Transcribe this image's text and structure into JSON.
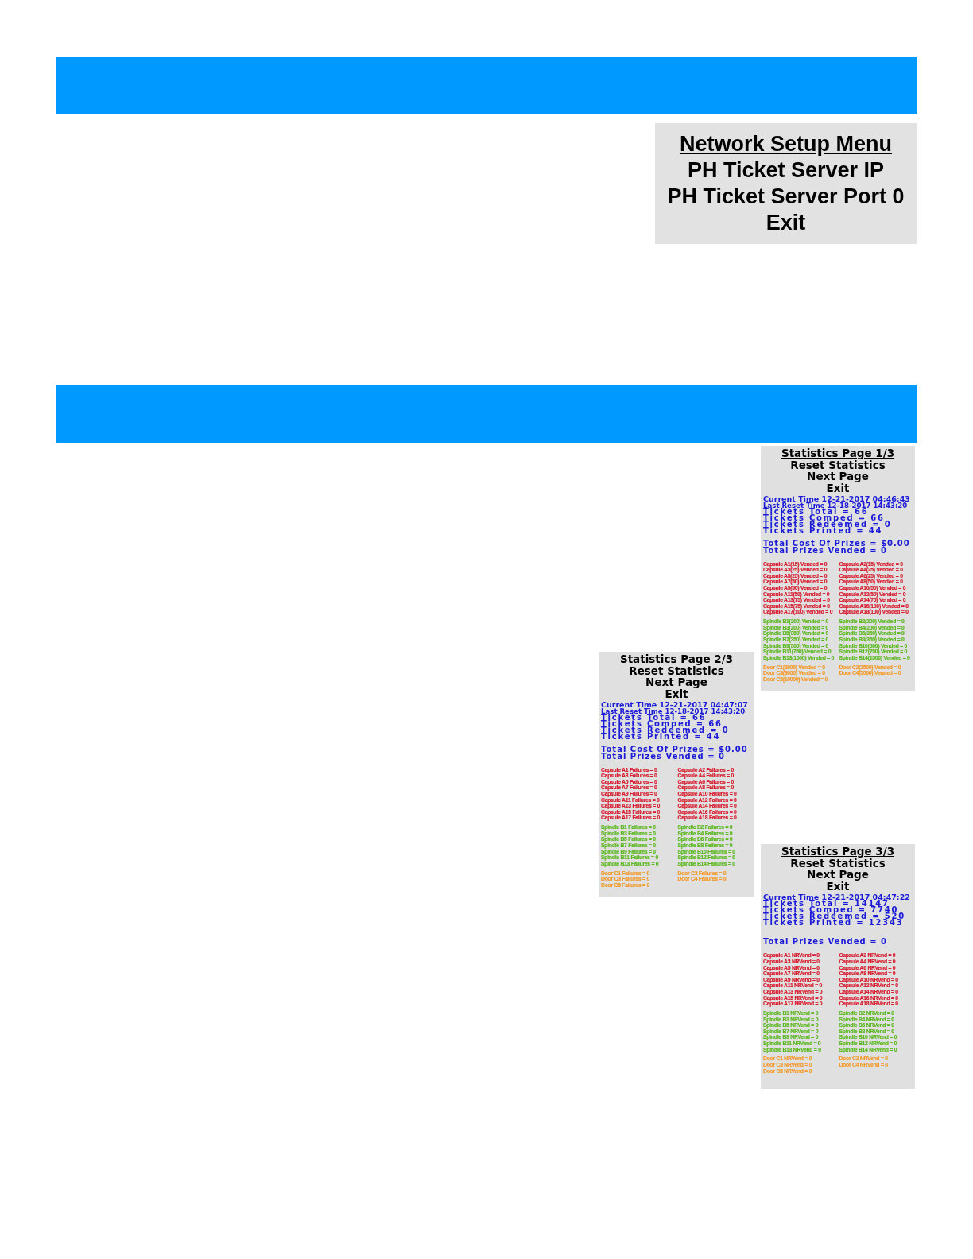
{
  "network_menu": {
    "title": "Network Setup Menu",
    "items": [
      "PH Ticket Server IP",
      "PH Ticket Server Port 0",
      "Exit"
    ]
  },
  "statistics_pages": [
    {
      "title": "Statistics Page 1/3",
      "menu": [
        "Reset Statistics",
        "Next Page",
        "Exit"
      ],
      "time_lines": [
        "Current Time 12-21-2017 04:46:43",
        "Last Reset Time 12-18-2017 14:43:20"
      ],
      "ticket_lines": [
        "Tickets Total = 66",
        "Tickets Comped = 66",
        "Tickets Redeemed = 0",
        "Tickets Printed = 44"
      ],
      "prize_lines": [
        "Total Cost Of Prizes = $0.00",
        "Total Prizes Vended = 0"
      ],
      "groups": [
        {
          "color": "#d81a2c",
          "entries": [
            "Capsule A1(15) Vended = 0",
            "Capsule A2(15) Vended = 0",
            "Capsule A3(25) Vended = 0",
            "Capsule A4(25) Vended = 0",
            "Capsule A5(25) Vended = 0",
            "Capsule A6(25) Vended = 0",
            "Capsule A7(50) Vended = 0",
            "Capsule A8(50) Vended = 0",
            "Capsule A9(50) Vended = 0",
            "Capsule A10(50) Vended = 0",
            "Capsule A11(50) Vended = 0",
            "Capsule A12(50) Vended = 0",
            "Capsule A13(75) Vended = 0",
            "Capsule A14(75) Vended = 0",
            "Capsule A15(75) Vended = 0",
            "Capsule A16(100) Vended = 0",
            "Capsule A17(100) Vended = 0",
            "Capsule A18(100) Vended = 0"
          ]
        },
        {
          "color": "#5ab81e",
          "entries": [
            "Spindle B1(200) Vended = 0",
            "Spindle B2(200) Vended = 0",
            "Spindle B3(200) Vended = 0",
            "Spindle B4(200) Vended = 0",
            "Spindle B5(350) Vended = 0",
            "Spindle B6(350) Vended = 0",
            "Spindle B7(350) Vended = 0",
            "Spindle B8(350) Vended = 0",
            "Spindle B9(500) Vended = 0",
            "Spindle B10(500) Vended = 0",
            "Spindle B11(750) Vended = 0",
            "Spindle B12(750) Vended = 0",
            "Spindle B13(1000) Vended = 0",
            "Spindle B14(1500) Vended = 0"
          ]
        },
        {
          "color": "#f39a2a",
          "entries": [
            "Door C1(2000) Vended = 0",
            "Door C2(2500) Vended = 0",
            "Door C3(3000) Vended = 0",
            "Door C4(5000) Vended = 0",
            "Door C5(10000) Vended = 0"
          ]
        }
      ]
    },
    {
      "title": "Statistics Page 2/3",
      "menu": [
        "Reset Statistics",
        "Next Page",
        "Exit"
      ],
      "time_lines": [
        "Current Time 12-21-2017 04:47:07",
        "Last Reset Time 12-18-2017 14:43:20"
      ],
      "ticket_lines": [
        "Tickets Total = 66",
        "Tickets Comped = 66",
        "Tickets Redeemed = 0",
        "Tickets Printed = 44"
      ],
      "prize_lines": [
        "Total Cost Of Prizes = $0.00",
        "Total Prizes Vended = 0"
      ],
      "groups": [
        {
          "color": "#d81a2c",
          "entries": [
            "Capsule A1 Failures = 0",
            "Capsule A2 Failures = 0",
            "Capsule A3 Failures = 0",
            "Capsule A4 Failures = 0",
            "Capsule A5 Failures = 0",
            "Capsule A6 Failures = 0",
            "Capsule A7 Failures = 0",
            "Capsule A8 Failures = 0",
            "Capsule A9 Failures = 0",
            "Capsule A10 Failures = 0",
            "Capsule A11 Failures = 0",
            "Capsule A12 Failures = 0",
            "Capsule A13 Failures = 0",
            "Capsule A14 Failures = 0",
            "Capsule A15 Failures = 0",
            "Capsule A16 Failures = 0",
            "Capsule A17 Failures = 0",
            "Capsule A18 Failures = 0"
          ]
        },
        {
          "color": "#5ab81e",
          "entries": [
            "Spindle B1 Failures = 0",
            "Spindle B2 Failures = 0",
            "Spindle B3 Failures = 0",
            "Spindle B4 Failures = 0",
            "Spindle B5 Failures = 0",
            "Spindle B6 Failures = 0",
            "Spindle B7 Failures = 0",
            "Spindle B8 Failures = 0",
            "Spindle B9 Failures = 0",
            "Spindle B10 Failures = 0",
            "Spindle B11 Failures = 0",
            "Spindle B12 Failures = 0",
            "Spindle B13 Failures = 0",
            "Spindle B14 Failures = 0"
          ]
        },
        {
          "color": "#f39a2a",
          "entries": [
            "Door C1 Failures = 0",
            "Door C2 Failures = 0",
            "Door C3 Failures = 0",
            "Door C4 Failures = 0",
            "Door C5 Failures = 0"
          ]
        }
      ]
    },
    {
      "title": "Statistics Page 3/3",
      "menu": [
        "Reset Statistics",
        "Next Page",
        "Exit"
      ],
      "time_lines": [
        "Current Time 12-21-2017 04:47:22"
      ],
      "ticket_lines": [
        "Tickets Total = 14147",
        "Tickets Comped = 7740",
        "Tickets Redeemed = 520",
        "Tickets Printed = 12343"
      ],
      "prize_lines": [
        "Total Prizes Vended = 0"
      ],
      "groups": [
        {
          "color": "#d81a2c",
          "entries": [
            "Capsule A1 NRVend = 0",
            "Capsule A2 NRVend = 0",
            "Capsule A3 NRVend = 0",
            "Capsule A4 NRVend = 0",
            "Capsule A5 NRVend = 0",
            "Capsule A6 NRVend = 0",
            "Capsule A7 NRVend = 0",
            "Capsule A8 NRVend = 0",
            "Capsule A9 NRVend = 0",
            "Capsule A10 NRVend = 0",
            "Capsule A11 NRVend = 0",
            "Capsule A12 NRVend = 0",
            "Capsule A13 NRVend = 0",
            "Capsule A14 NRVend = 0",
            "Capsule A15 NRVend = 0",
            "Capsule A16 NRVend = 0",
            "Capsule A17 NRVend = 0",
            "Capsule A18 NRVend = 0"
          ]
        },
        {
          "color": "#5ab81e",
          "entries": [
            "Spindle B1 NRVend = 0",
            "Spindle B2 NRVend = 0",
            "Spindle B3 NRVend = 0",
            "Spindle B4 NRVend = 0",
            "Spindle B5 NRVend = 0",
            "Spindle B6 NRVend = 0",
            "Spindle B7 NRVend = 0",
            "Spindle B8 NRVend = 0",
            "Spindle B9 NRVend = 0",
            "Spindle B10 NRVend = 0",
            "Spindle B11 NRVend = 0",
            "Spindle B12 NRVend = 0",
            "Spindle B13 NRVend = 0",
            "Spindle B14 NRVend = 0"
          ]
        },
        {
          "color": "#f39a2a",
          "entries": [
            "Door C1 NRVend = 0",
            "Door C2 NRVend = 0",
            "Door C3 NRVend = 0",
            "Door C4 NRVend = 0",
            "Door C5 NRVend = 0"
          ]
        }
      ]
    }
  ]
}
